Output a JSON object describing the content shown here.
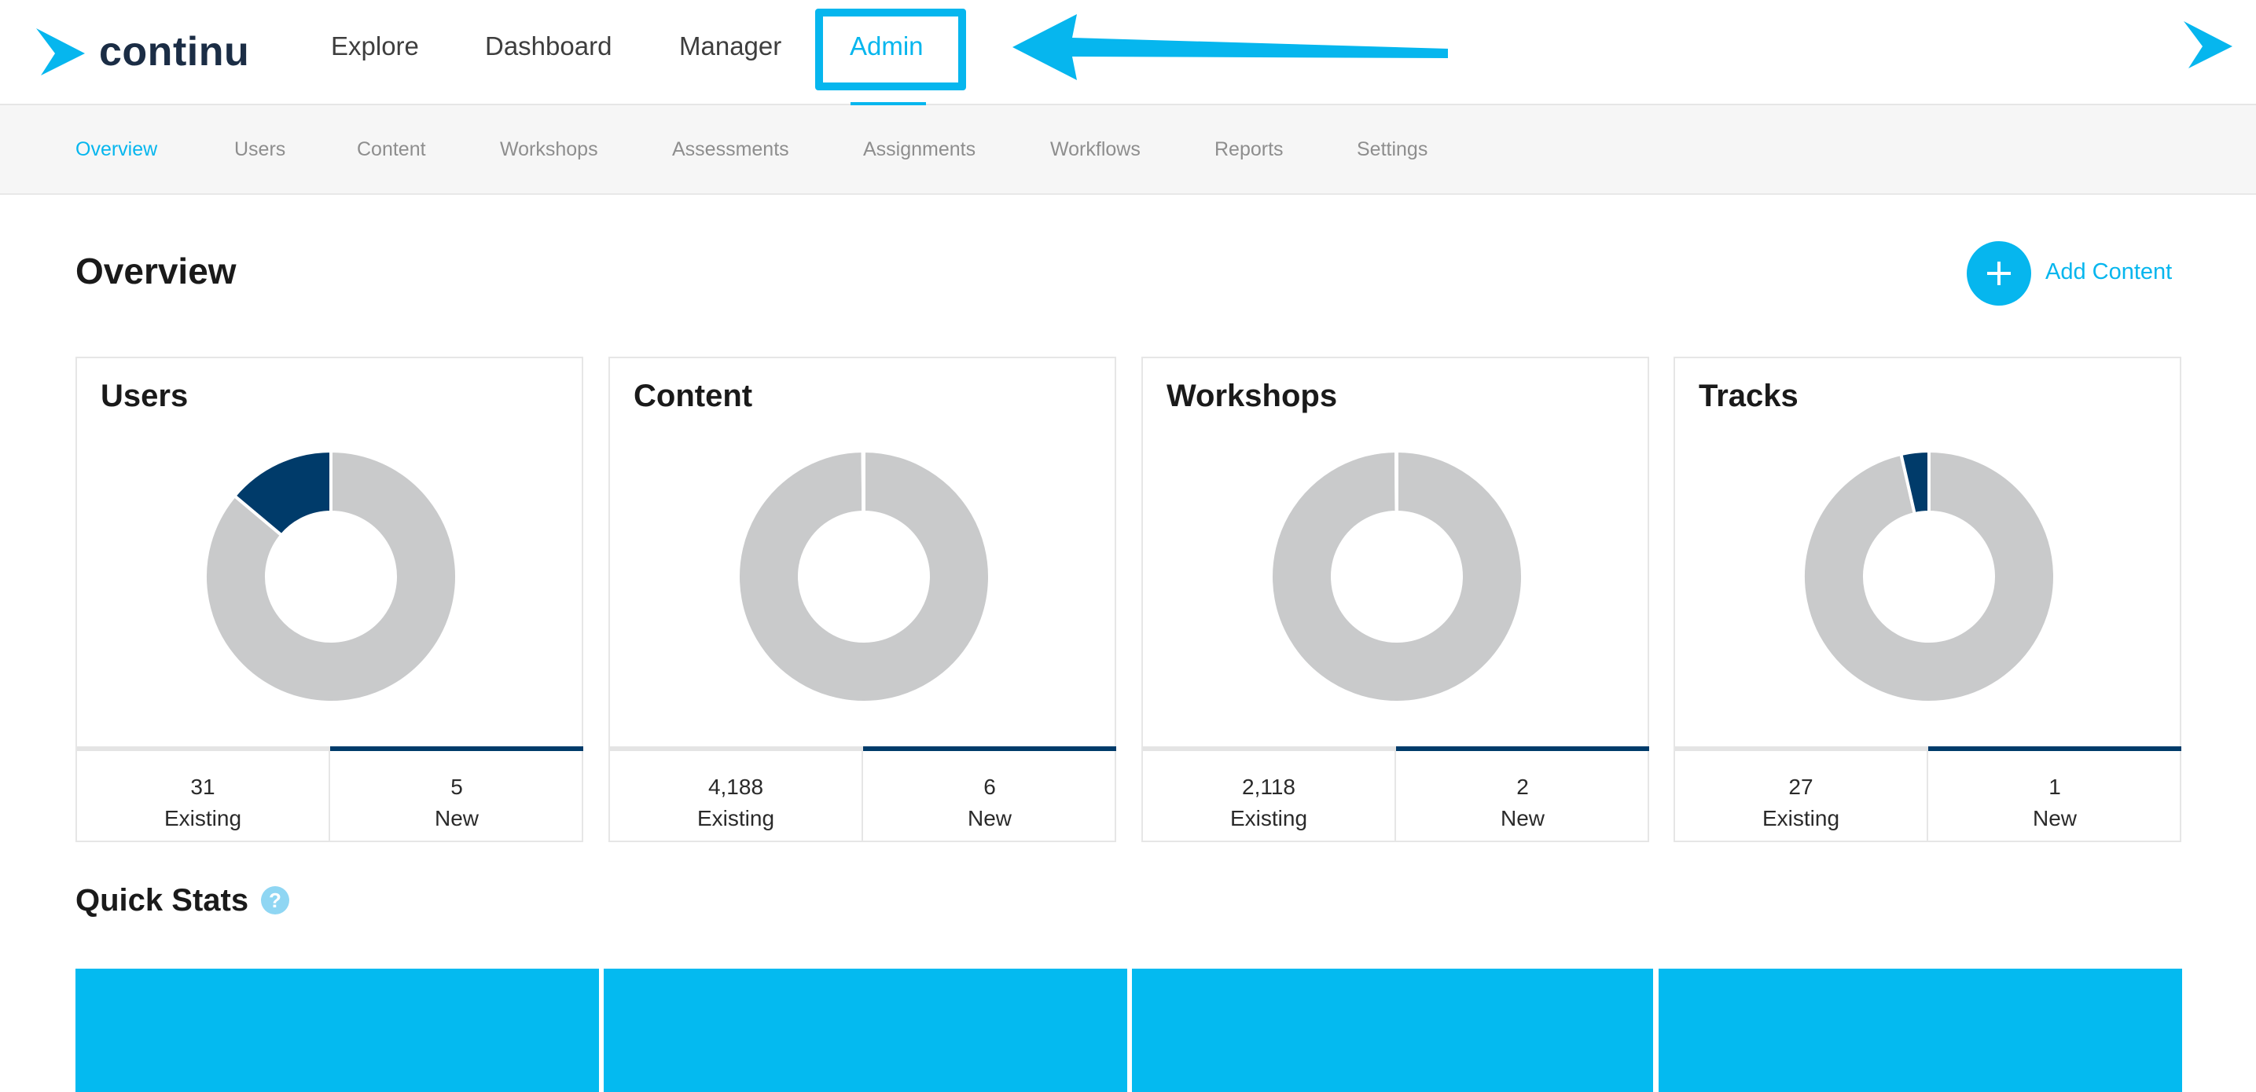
{
  "brand": {
    "name": "continu",
    "accent": "#06b6ee",
    "dark": "#003b6a",
    "neutral": "#c9cacb"
  },
  "topnav": {
    "items": [
      "Explore",
      "Dashboard",
      "Manager",
      "Admin"
    ],
    "active": "Admin"
  },
  "subnav": {
    "items": [
      "Overview",
      "Users",
      "Content",
      "Workshops",
      "Assessments",
      "Assignments",
      "Workflows",
      "Reports",
      "Settings"
    ],
    "active": "Overview"
  },
  "page": {
    "title": "Overview",
    "add_label": "Add Content"
  },
  "cards": [
    {
      "title": "Users",
      "existing": "31",
      "new": "5",
      "existing_label": "Existing",
      "new_label": "New"
    },
    {
      "title": "Content",
      "existing": "4,188",
      "new": "6",
      "existing_label": "Existing",
      "new_label": "New"
    },
    {
      "title": "Workshops",
      "existing": "2,118",
      "new": "2",
      "existing_label": "Existing",
      "new_label": "New"
    },
    {
      "title": "Tracks",
      "existing": "27",
      "new": "1",
      "existing_label": "Existing",
      "new_label": "New"
    }
  ],
  "quick_stats": {
    "title": "Quick Stats",
    "help": "?"
  },
  "chart_data": [
    {
      "type": "pie",
      "title": "Users",
      "categories": [
        "Existing",
        "New"
      ],
      "values": [
        31,
        5
      ]
    },
    {
      "type": "pie",
      "title": "Content",
      "categories": [
        "Existing",
        "New"
      ],
      "values": [
        4188,
        6
      ]
    },
    {
      "type": "pie",
      "title": "Workshops",
      "categories": [
        "Existing",
        "New"
      ],
      "values": [
        2118,
        2
      ]
    },
    {
      "type": "pie",
      "title": "Tracks",
      "categories": [
        "Existing",
        "New"
      ],
      "values": [
        27,
        1
      ]
    }
  ]
}
